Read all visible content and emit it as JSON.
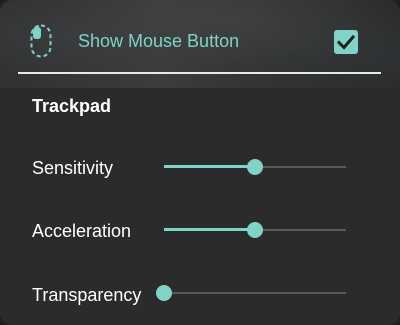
{
  "header": {
    "label": "Show Mouse Button",
    "icon": "mouse-icon",
    "checked": true
  },
  "section": {
    "title": "Trackpad"
  },
  "sliders": [
    {
      "label": "Sensitivity",
      "value": 0.5
    },
    {
      "label": "Acceleration",
      "value": 0.5
    },
    {
      "label": "Transparency",
      "value": 0.0
    }
  ],
  "colors": {
    "accent": "#7fd3c9",
    "background": "#2b2b2b",
    "track": "#5a5a5a",
    "text": "#ffffff"
  }
}
